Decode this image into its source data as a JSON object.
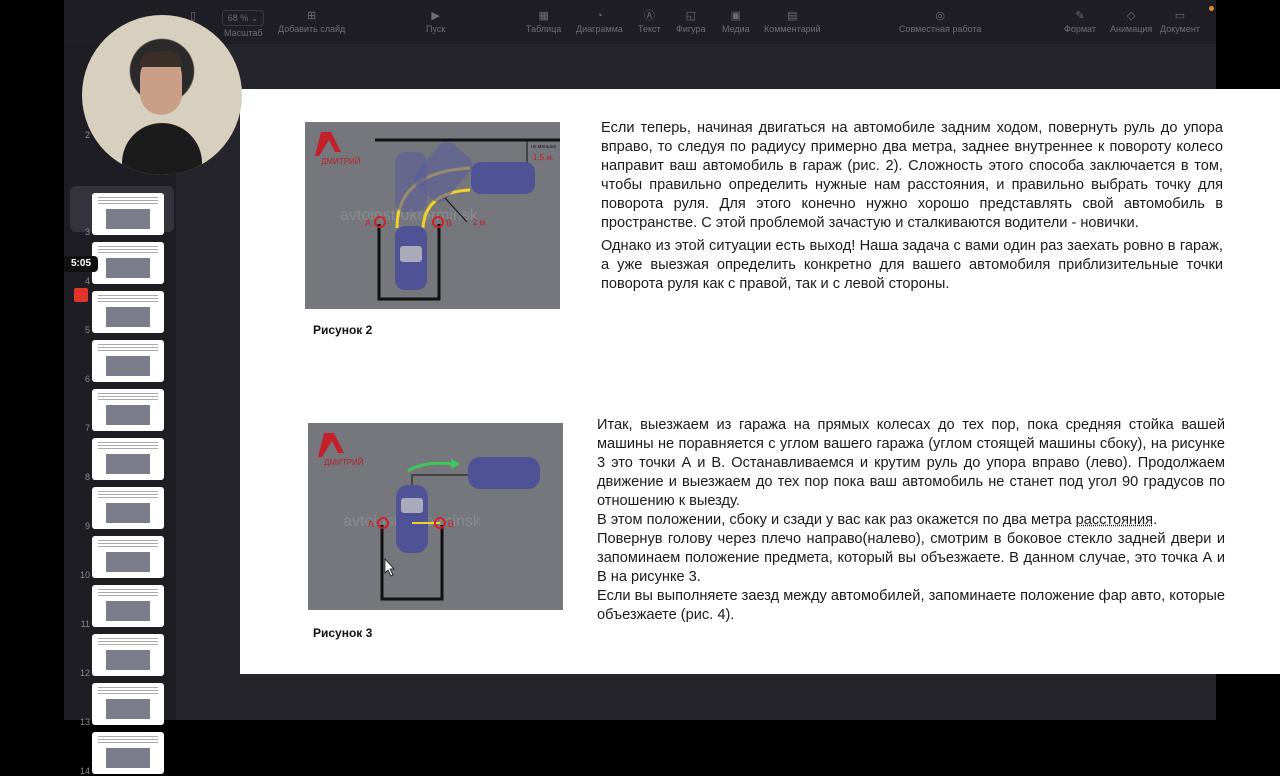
{
  "toolbar": {
    "zoom_value": "68 %",
    "items": [
      {
        "label": "Масштаб",
        "icon": "zoom-icon"
      },
      {
        "label": "Добавить слайд",
        "icon": "add-slide-icon"
      },
      {
        "label": "Пуск",
        "icon": "play-icon"
      },
      {
        "label": "Таблица",
        "icon": "table-icon"
      },
      {
        "label": "Диаграмма",
        "icon": "chart-icon"
      },
      {
        "label": "Текст",
        "icon": "text-icon"
      },
      {
        "label": "Фигура",
        "icon": "shape-icon"
      },
      {
        "label": "Медиа",
        "icon": "media-icon"
      },
      {
        "label": "Комментарий",
        "icon": "comment-icon"
      },
      {
        "label": "Совместная работа",
        "icon": "collaborate-icon"
      },
      {
        "label": "Формат",
        "icon": "format-icon"
      },
      {
        "label": "Анимация",
        "icon": "animation-icon"
      },
      {
        "label": "Документ",
        "icon": "document-icon"
      }
    ]
  },
  "sidebar": {
    "slide_numbers": [
      "2",
      "3",
      "4",
      "5",
      "6",
      "7",
      "8",
      "9",
      "10",
      "11",
      "12",
      "13",
      "14"
    ],
    "selected": "3"
  },
  "recording": {
    "timer": "5:05"
  },
  "figure2": {
    "caption": "Рисунок 2",
    "logo": "ДМИТРИЙ",
    "watermark": "avtoinstruktorminsk",
    "point_a": "A",
    "point_b": "B",
    "radius": "2 м.",
    "min_label": "не меньше",
    "min_dist": "1,5 м."
  },
  "figure3": {
    "caption": "Рисунок 3",
    "logo": "ДМИТРИЙ",
    "watermark": "avtoinstruktorminsk",
    "point_a": "A",
    "point_b": "B"
  },
  "text1": {
    "p1": "Если теперь, начиная двигаться на автомобиле задним ходом, повернуть руль до упора вправо, то следуя по радиусу примерно два метра, заднее внутреннее к повороту колесо направит ваш  автомобиль в гараж (рис. 2). Сложность этого способа заключается в том, чтобы правильно определить нужные нам расстояния, и правильно выбрать точку для поворота руля.  Для этого конечно нужно хорошо представлять свой автомобиль в пространстве. С этой проблемой зачастую и сталкиваются  водители - новички.",
    "p2": "Однако из  этой ситуации есть выход! Наша задача с вами один раз заехать ровно в гараж, а уже выезжая определить конкретно для вашего автомобиля приблизительные точки поворота руля как с правой, так и с левой стороны."
  },
  "text2": {
    "p1": "Итак, выезжаем из гаража на прямых колесах до тех пор, пока средняя стойка вашей машины не поравняется с углом вашего гаража (углом стоящей машины сбоку), на рисунке 3 это точки А и В. Останавливаемся и крутим руль до упора вправо (лево). Продолжаем движение и выезжаем до тех пор пока ваш автомобиль не станет под угол  90 градусов по отношению к выезду.",
    "p2a": "В этом положении, сбоку и сзади у вас как раз окажется по два метра ",
    "p2b": "расстояния",
    "p2c": ".",
    "p3": "Повернув голову через плечо  направо(налево), смотрим в боковое стекло задней двери и  запоминаем положение предмета,  который вы объезжаете. В данном случае, это точка А и В на рисунке 3.",
    "p4": "Если вы выполняете заезд между автомобилей, запоминаете положение фар авто, которые объезжаете (рис. 4)."
  },
  "colors": {
    "accent_record": "#e0352b",
    "car": "#4f5395",
    "path": "#f2d12b",
    "arrow": "#3ec85a",
    "marker": "#d0202a"
  }
}
